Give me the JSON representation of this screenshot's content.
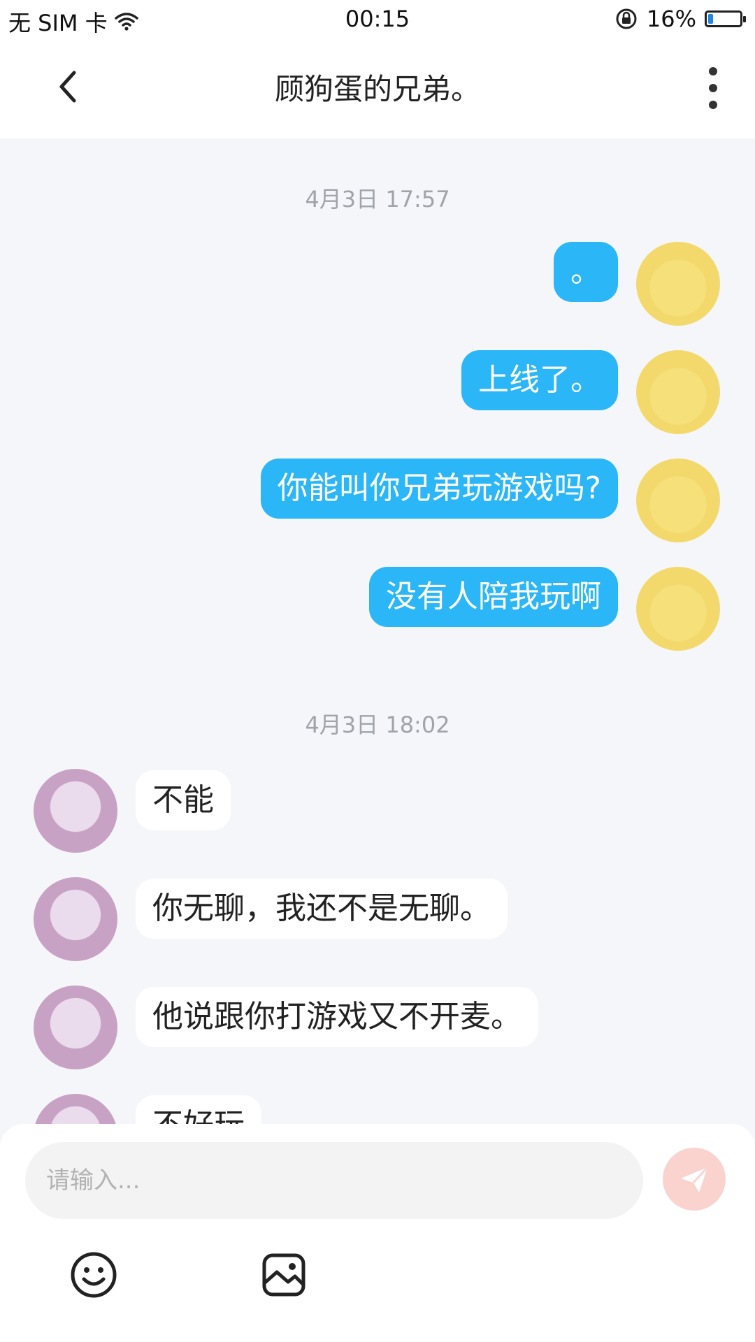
{
  "status_bar": {
    "carrier": "无 SIM 卡",
    "time": "00:15",
    "battery": "16%",
    "battery_level": 0.16
  },
  "header": {
    "title": "顾狗蛋的兄弟。"
  },
  "chat": {
    "timestamps": [
      "4月3日 17:57",
      "4月3日 18:02"
    ],
    "messages_me": [
      "。",
      "上线了。",
      "你能叫你兄弟玩游戏吗?",
      "没有人陪我玩啊"
    ],
    "messages_other": [
      "不能",
      "你无聊，我还不是无聊。",
      "他说跟你打游戏又不开麦。",
      "不好玩"
    ]
  },
  "composer": {
    "placeholder": "请输入..."
  },
  "colors": {
    "my_bubble": "#2bb6f7",
    "other_bubble": "#ffffff",
    "send_button": "#fbd3ce",
    "background": "#f4f6f9"
  },
  "icons": {
    "back": "chevron-left-icon",
    "more": "more-vertical-icon",
    "wifi": "wifi-icon",
    "rotation_lock": "rotation-lock-icon",
    "battery": "battery-icon",
    "send": "send-icon",
    "emoji": "emoji-icon",
    "image": "image-icon"
  }
}
